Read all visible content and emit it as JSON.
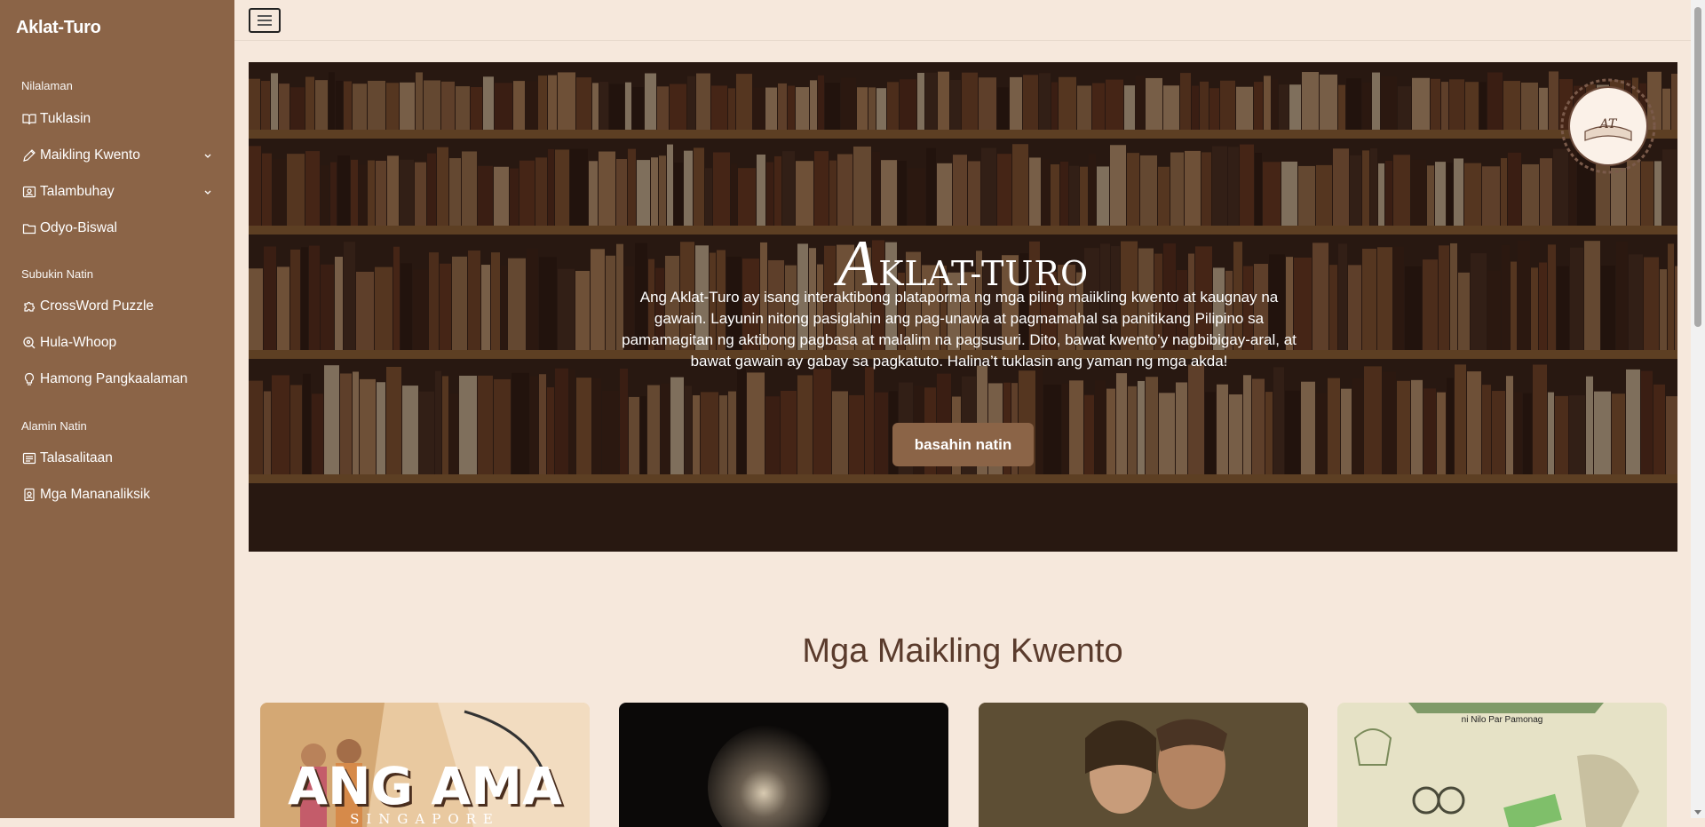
{
  "sidebar": {
    "brand": "Aklat-Turo",
    "sections": [
      {
        "heading": "Nilalaman",
        "items": [
          {
            "label": "Tuklasin",
            "icon": "book-open-icon"
          },
          {
            "label": "Maikling Kwento",
            "icon": "pencil-icon",
            "expandable": true
          },
          {
            "label": "Talambuhay",
            "icon": "person-card-icon",
            "expandable": true
          },
          {
            "label": "Odyo-Biswal",
            "icon": "folder-icon"
          }
        ]
      },
      {
        "heading": "Subukin Natin",
        "items": [
          {
            "label": "CrossWord Puzzle",
            "icon": "puzzle-icon"
          },
          {
            "label": "Hula-Whoop",
            "icon": "magnifier-icon"
          },
          {
            "label": "Hamong Pangkaalaman",
            "icon": "lightbulb-icon"
          }
        ]
      },
      {
        "heading": "Alamin Natin",
        "items": [
          {
            "label": "Talasalitaan",
            "icon": "list-icon"
          },
          {
            "label": "Mga Mananaliksik",
            "icon": "id-badge-icon"
          }
        ]
      }
    ]
  },
  "hero": {
    "title_initial": "A",
    "title_rest": "KLAT-TURO",
    "description": "Ang Aklat-Turo ay isang interaktibong plataporma ng mga piling maiikling kwento at kaugnay na gawain. Layunin nitong pasiglahin ang pag-unawa at pagmamahal sa panitikang Pilipino sa pamamagitan ng aktibong pagbasa at malalim na pagsusuri. Dito, bawat kwento’y nagbibigay-aral, at bawat gawain ay gabay sa pagkatuto. Halina’t tuklasin ang yaman ng mga akda!",
    "button_label": "basahin natin"
  },
  "stories_section": {
    "title": "Mga Maikling Kwento",
    "cards": [
      {
        "art_text": "ANG AMA",
        "sub_text": "SINGAPORE"
      },
      {
        "art_text": "",
        "sub_text": ""
      },
      {
        "art_text": "",
        "sub_text": ""
      },
      {
        "art_text": "",
        "sub_text": "ni Nilo Par Pamonag"
      }
    ]
  },
  "colors": {
    "sidebar": "#8b6447",
    "page_bg": "#f6e8dc",
    "heading": "#5a3b2c"
  }
}
